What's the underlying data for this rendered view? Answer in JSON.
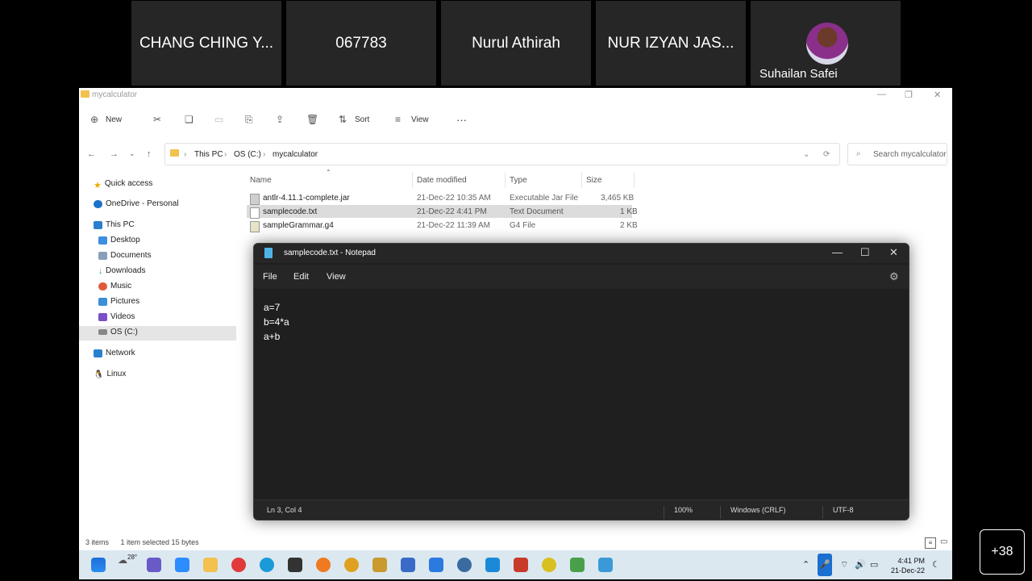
{
  "participants": [
    {
      "name": "CHANG CHING Y..."
    },
    {
      "name": "067783"
    },
    {
      "name": "Nurul Athirah"
    },
    {
      "name": "NUR IZYAN JAS..."
    },
    {
      "name": "Suhailan Safei"
    }
  ],
  "more_participants": "+38",
  "explorer": {
    "title": "mycalculator",
    "toolbar": {
      "new": "New",
      "sort": "Sort",
      "view": "View",
      "more": "···"
    },
    "address": [
      "This PC",
      "OS (C:)",
      "mycalculator"
    ],
    "search_placeholder": "Search mycalculator",
    "sidebar": [
      "Quick access",
      "OneDrive - Personal",
      "This PC",
      "Desktop",
      "Documents",
      "Downloads",
      "Music",
      "Pictures",
      "Videos",
      "OS (C:)",
      "Network",
      "Linux"
    ],
    "columns": [
      "Name",
      "Date modified",
      "Type",
      "Size"
    ],
    "files": [
      {
        "name": "antlr-4.11.1-complete.jar",
        "date": "21-Dec-22 10:35 AM",
        "type": "Executable Jar File",
        "size": "3,465 KB"
      },
      {
        "name": "samplecode.txt",
        "date": "21-Dec-22 4:41 PM",
        "type": "Text Document",
        "size": "1 KB"
      },
      {
        "name": "sampleGrammar.g4",
        "date": "21-Dec-22 11:39 AM",
        "type": "G4 File",
        "size": "2 KB"
      }
    ],
    "status": {
      "items": "3 items",
      "selected": "1 item selected  15 bytes"
    }
  },
  "notepad": {
    "title": "samplecode.txt - Notepad",
    "menu": [
      "File",
      "Edit",
      "View"
    ],
    "content": "a=7\nb=4*a\na+b",
    "status": {
      "position": "Ln 3, Col 4",
      "zoom": "100%",
      "eol": "Windows (CRLF)",
      "encoding": "UTF-8"
    }
  },
  "taskbar": {
    "weather": "28°",
    "time": "4:41 PM",
    "date": "21-Dec-22"
  }
}
